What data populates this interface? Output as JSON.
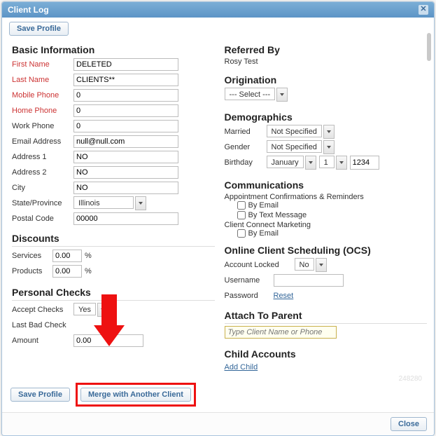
{
  "window": {
    "title": "Client Log",
    "close_glyph": "✕"
  },
  "buttons": {
    "save_profile": "Save Profile",
    "merge": "Merge with Another Client",
    "close": "Close"
  },
  "basic": {
    "heading": "Basic Information",
    "first_name_label": "First Name",
    "first_name": "DELETED",
    "last_name_label": "Last Name",
    "last_name": "CLIENTS**",
    "mobile_label": "Mobile Phone",
    "mobile": "0",
    "home_label": "Home Phone",
    "home": "0",
    "work_label": "Work Phone",
    "work": "0",
    "email_label": "Email Address",
    "email": "null@null.com",
    "addr1_label": "Address 1",
    "addr1": "NO",
    "addr2_label": "Address 2",
    "addr2": "NO",
    "city_label": "City",
    "city": "NO",
    "state_label": "State/Province",
    "state": "Illinois",
    "postal_label": "Postal Code",
    "postal": "00000"
  },
  "discounts": {
    "heading": "Discounts",
    "services_label": "Services",
    "services": "0.00",
    "products_label": "Products",
    "products": "0.00",
    "pct": "%"
  },
  "checks": {
    "heading": "Personal Checks",
    "accept_label": "Accept Checks",
    "accept": "Yes",
    "lastbad_label": "Last Bad Check",
    "lastbad": "",
    "amount_label": "Amount",
    "amount": "0.00"
  },
  "referred": {
    "heading": "Referred By",
    "value": "Rosy Test"
  },
  "origination": {
    "heading": "Origination",
    "value": "--- Select ---"
  },
  "demo": {
    "heading": "Demographics",
    "married_label": "Married",
    "married": "Not Specified",
    "gender_label": "Gender",
    "gender": "Not Specified",
    "birthday_label": "Birthday",
    "birthday_month": "January",
    "birthday_day": "1",
    "birthday_year": "1234"
  },
  "comms": {
    "heading": "Communications",
    "appt": "Appointment Confirmations & Reminders",
    "by_email": "By Email",
    "by_text": "By Text Message",
    "ccm": "Client Connect Marketing"
  },
  "ocs": {
    "heading": "Online Client Scheduling (OCS)",
    "locked_label": "Account Locked",
    "locked": "No",
    "username_label": "Username",
    "username": "",
    "password_label": "Password",
    "reset": "Reset"
  },
  "parent": {
    "heading": "Attach To Parent",
    "placeholder": "Type Client Name or Phone"
  },
  "children": {
    "heading": "Child Accounts",
    "add": "Add Child"
  },
  "ghost": "248280"
}
